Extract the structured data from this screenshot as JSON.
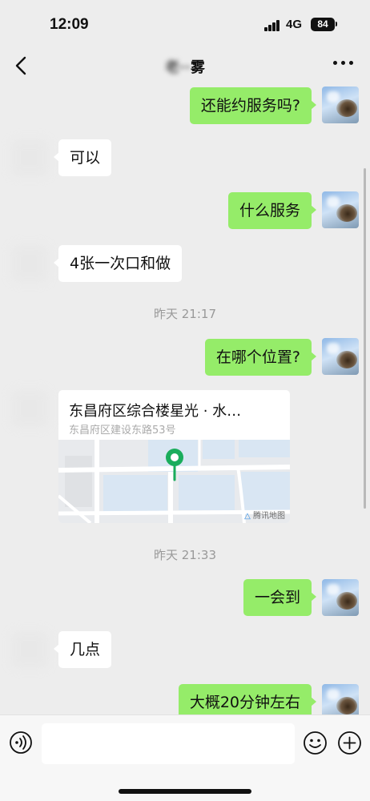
{
  "status_bar": {
    "time": "12:09",
    "network": "4G",
    "battery": "84"
  },
  "nav": {
    "title_blurred": "老··",
    "title_visible": "雾"
  },
  "messages": [
    {
      "from": "me",
      "text": "还能约服务吗?"
    },
    {
      "from": "them",
      "text": "可以"
    },
    {
      "from": "me",
      "text": "什么服务"
    },
    {
      "from": "them",
      "text": "4张一次口和做"
    },
    {
      "type": "time",
      "text": "昨天 21:17"
    },
    {
      "from": "me",
      "text": "在哪个位置?"
    },
    {
      "from": "them",
      "type": "location",
      "title": "东昌府区综合楼星光 · 水…",
      "address": "东昌府区建设东路53号",
      "map_label": "腾讯地图"
    },
    {
      "type": "time",
      "text": "昨天 21:33"
    },
    {
      "from": "me",
      "text": "一会到"
    },
    {
      "from": "them",
      "text": "几点"
    },
    {
      "from": "me",
      "text": "大概20分钟左右"
    }
  ],
  "colors": {
    "background": "#ededed",
    "my_bubble": "#95ec69",
    "their_bubble": "#ffffff",
    "location_pin": "#1aad5c"
  }
}
